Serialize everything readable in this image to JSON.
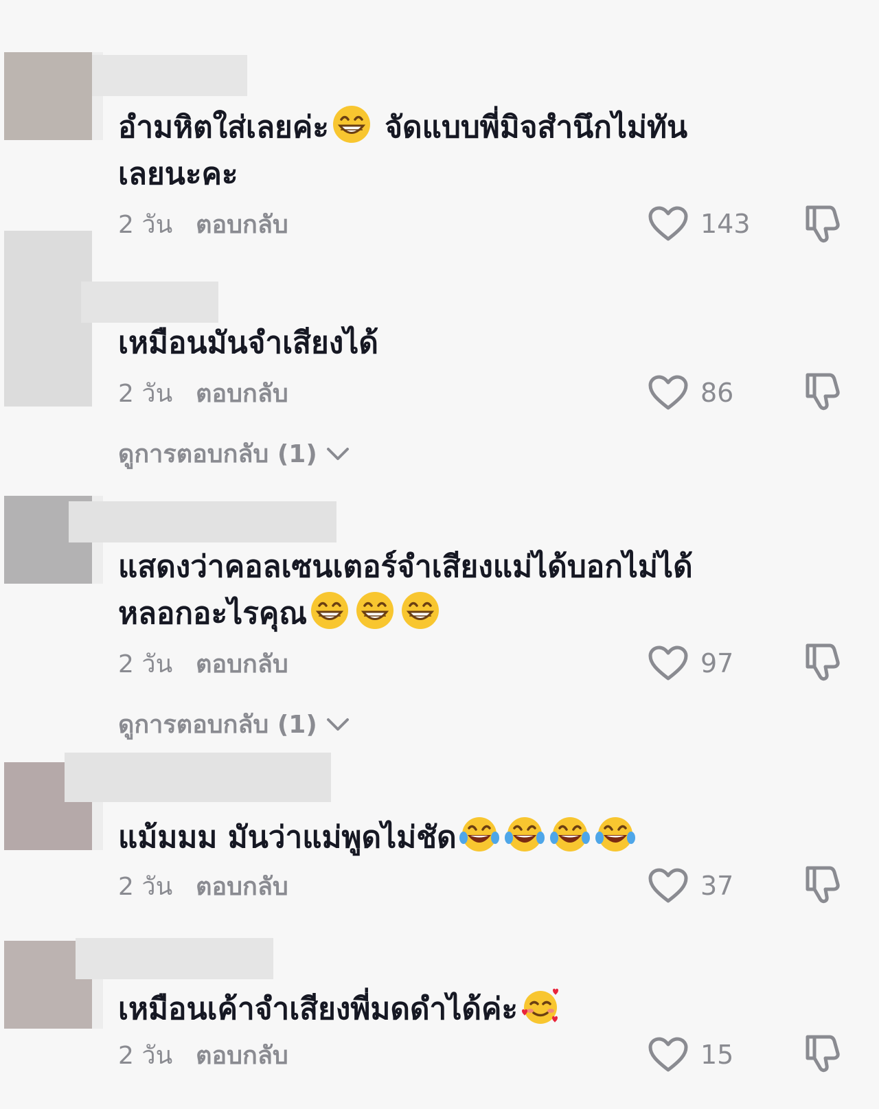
{
  "colors": {
    "background": "#f7f7f7",
    "text": "#161823",
    "meta": "#8a8b91"
  },
  "comments": [
    {
      "parts": [
        "อำมหิตใส่เลยค่ะ",
        " จัดแบบพี่มิจสำนึกไม่ทัน"
      ],
      "line2": "เลยนะคะ",
      "time": "2 วัน",
      "reply": "ตอบกลับ",
      "likes": "143",
      "emoji": "grinning-face-with-smiling-eyes"
    },
    {
      "parts": [
        "เหมือนมันจำเสียงได้"
      ],
      "time": "2 วัน",
      "reply": "ตอบกลับ",
      "likes": "86",
      "view_replies": "ดูการตอบกลับ (1)"
    },
    {
      "parts": [
        "แสดงว่าคอลเซนเตอร์จำเสียงแม่ได้บอกไม่ได้"
      ],
      "line2": "หลอกอะไรคุณ",
      "time": "2 วัน",
      "reply": "ตอบกลับ",
      "likes": "97",
      "view_replies": "ดูการตอบกลับ (1)",
      "emoji": "grinning-face-with-smiling-eyes"
    },
    {
      "parts": [
        "แม้มมม มันว่าแม่พูดไม่ชัด"
      ],
      "time": "2 วัน",
      "reply": "ตอบกลับ",
      "likes": "37",
      "emoji": "face-with-tears-of-joy"
    },
    {
      "parts": [
        "เหมือนเค้าจำเสียงพี่มดดำได้ค่ะ"
      ],
      "time": "2 วัน",
      "reply": "ตอบกลับ",
      "likes": "15",
      "emoji": "smiling-face-with-hearts"
    }
  ]
}
